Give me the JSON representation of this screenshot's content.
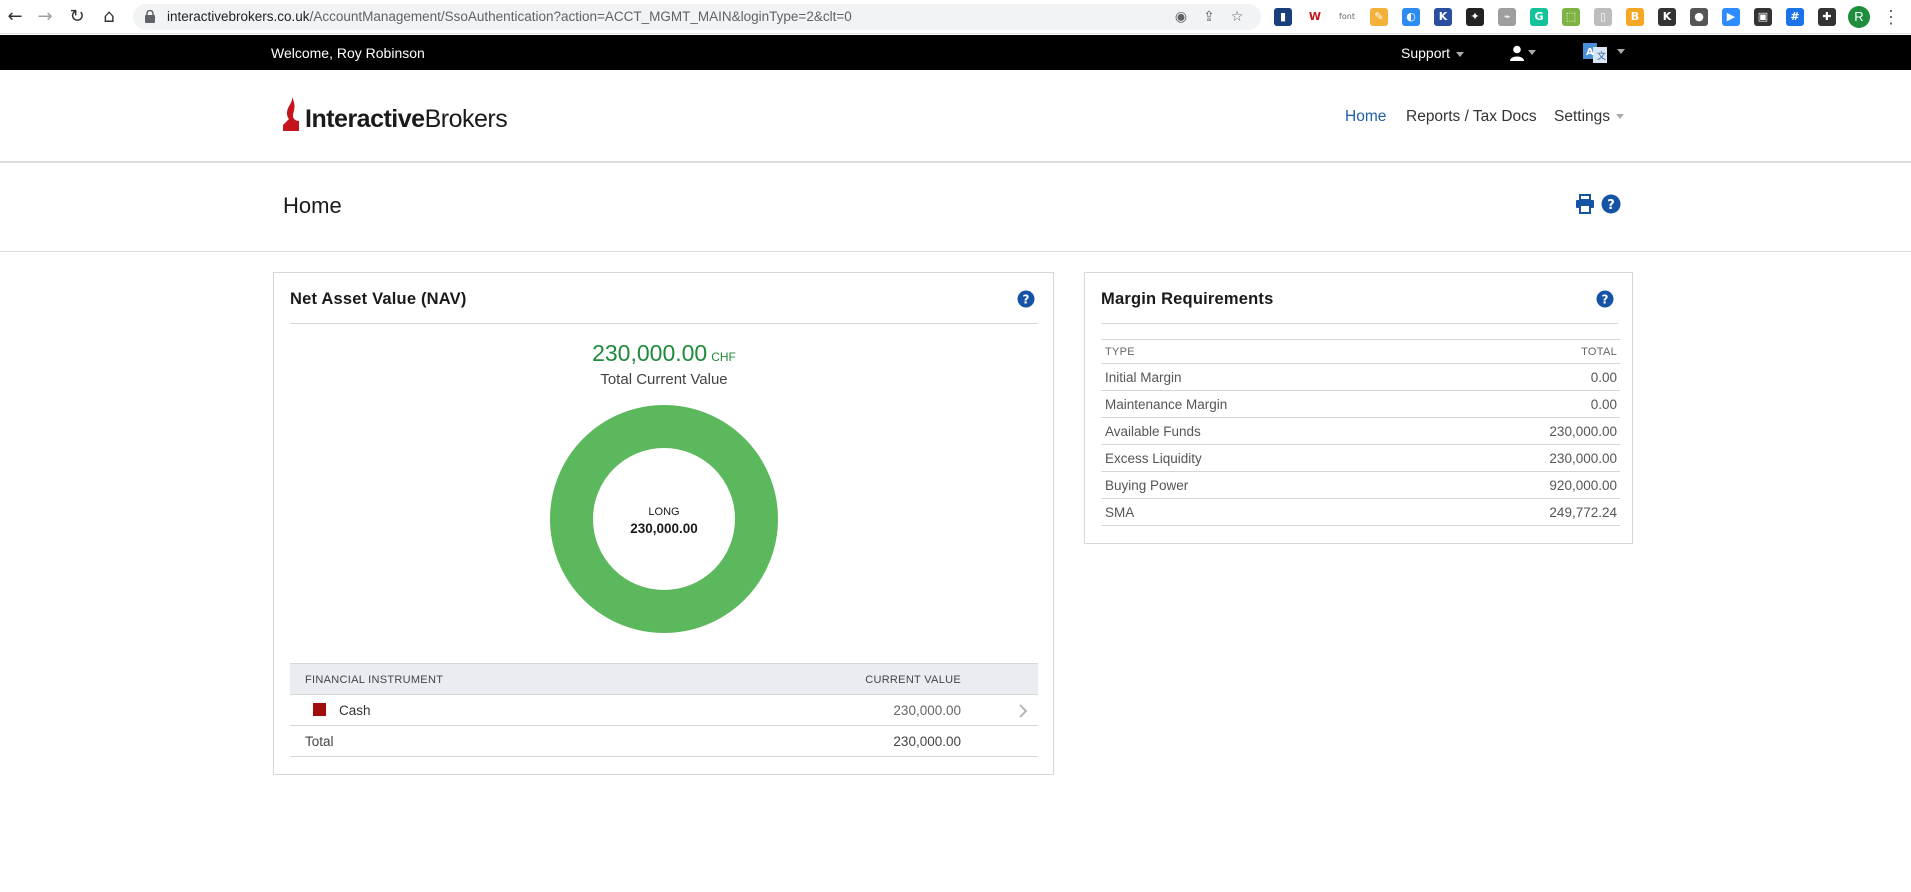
{
  "browser": {
    "url_host": "interactivebrokers.co.uk",
    "url_path": "/AccountManagement/SsoAuthentication?action=ACCT_MGMT_MAIN&loginType=2&clt=0",
    "profile_initial": "R",
    "extensions": [
      {
        "name": "ext-chart",
        "glyph": "▮",
        "color": "#1a3d7c"
      },
      {
        "name": "ext-w",
        "glyph": "W",
        "color": "#ffffff",
        "text_color": "#c4151c"
      },
      {
        "name": "ext-font",
        "glyph": "font",
        "color": "#ffffff",
        "text_color": "#666666"
      },
      {
        "name": "ext-paint",
        "glyph": "✎",
        "color": "#f3b13a"
      },
      {
        "name": "ext-circle",
        "glyph": "◐",
        "color": "#2d8cf0"
      },
      {
        "name": "ext-k",
        "glyph": "K",
        "color": "#2b4ea0"
      },
      {
        "name": "ext-ninja",
        "glyph": "✦",
        "color": "#222222"
      },
      {
        "name": "ext-pdf",
        "glyph": "⌁",
        "color": "#9e9e9e"
      },
      {
        "name": "ext-grammarly",
        "glyph": "G",
        "color": "#15c39a"
      },
      {
        "name": "ext-puzzle-2",
        "glyph": "⬚",
        "color": "#7cb342"
      },
      {
        "name": "ext-doc",
        "glyph": "▯",
        "color": "#bdbdbd"
      },
      {
        "name": "ext-b",
        "glyph": "B",
        "color": "#f5a623"
      },
      {
        "name": "ext-k2",
        "glyph": "K",
        "color": "#333333"
      },
      {
        "name": "ext-people",
        "glyph": "●",
        "color": "#555555"
      },
      {
        "name": "ext-video",
        "glyph": "▶",
        "color": "#2d8cff"
      },
      {
        "name": "ext-pip",
        "glyph": "▣",
        "color": "#333333"
      },
      {
        "name": "ext-grid",
        "glyph": "#",
        "color": "#1a73e8"
      },
      {
        "name": "ext-puzzle",
        "glyph": "✚",
        "color": "#333333"
      }
    ]
  },
  "topbar": {
    "welcome": "Welcome, Roy Robinson",
    "support": "Support"
  },
  "header": {
    "logo_bold": "Interactive",
    "logo_regular": "Brokers",
    "nav": [
      {
        "label": "Home",
        "active": true
      },
      {
        "label": "Reports / Tax Docs",
        "active": false
      },
      {
        "label": "Settings",
        "active": false
      }
    ]
  },
  "page": {
    "title": "Home"
  },
  "nav_panel": {
    "title": "Net Asset Value (NAV)",
    "total_value": "230,000.00",
    "currency": "CHF",
    "total_label": "Total Current Value",
    "donut_label": "LONG",
    "donut_value": "230,000.00",
    "donut_color": "#5cb85c",
    "table_headers": {
      "instrument": "FINANCIAL INSTRUMENT",
      "value": "CURRENT VALUE"
    },
    "rows": [
      {
        "name": "Cash",
        "value": "230,000.00",
        "color": "#a00d0d"
      }
    ],
    "total_row": {
      "label": "Total",
      "value": "230,000.00"
    }
  },
  "chart_data": {
    "type": "pie",
    "categories": [
      "LONG"
    ],
    "values": [
      230000.0
    ]
  },
  "margin_panel": {
    "title": "Margin Requirements",
    "headers": {
      "type": "TYPE",
      "total": "TOTAL"
    },
    "rows": [
      {
        "type": "Initial Margin",
        "total": "0.00"
      },
      {
        "type": "Maintenance Margin",
        "total": "0.00"
      },
      {
        "type": "Available Funds",
        "total": "230,000.00"
      },
      {
        "type": "Excess Liquidity",
        "total": "230,000.00"
      },
      {
        "type": "Buying Power",
        "total": "920,000.00"
      },
      {
        "type": "SMA",
        "total": "249,772.24"
      }
    ]
  },
  "colors": {
    "accent": "#1f5fa8",
    "positive": "#1e8a3c",
    "help_icon": "#1553a5"
  }
}
